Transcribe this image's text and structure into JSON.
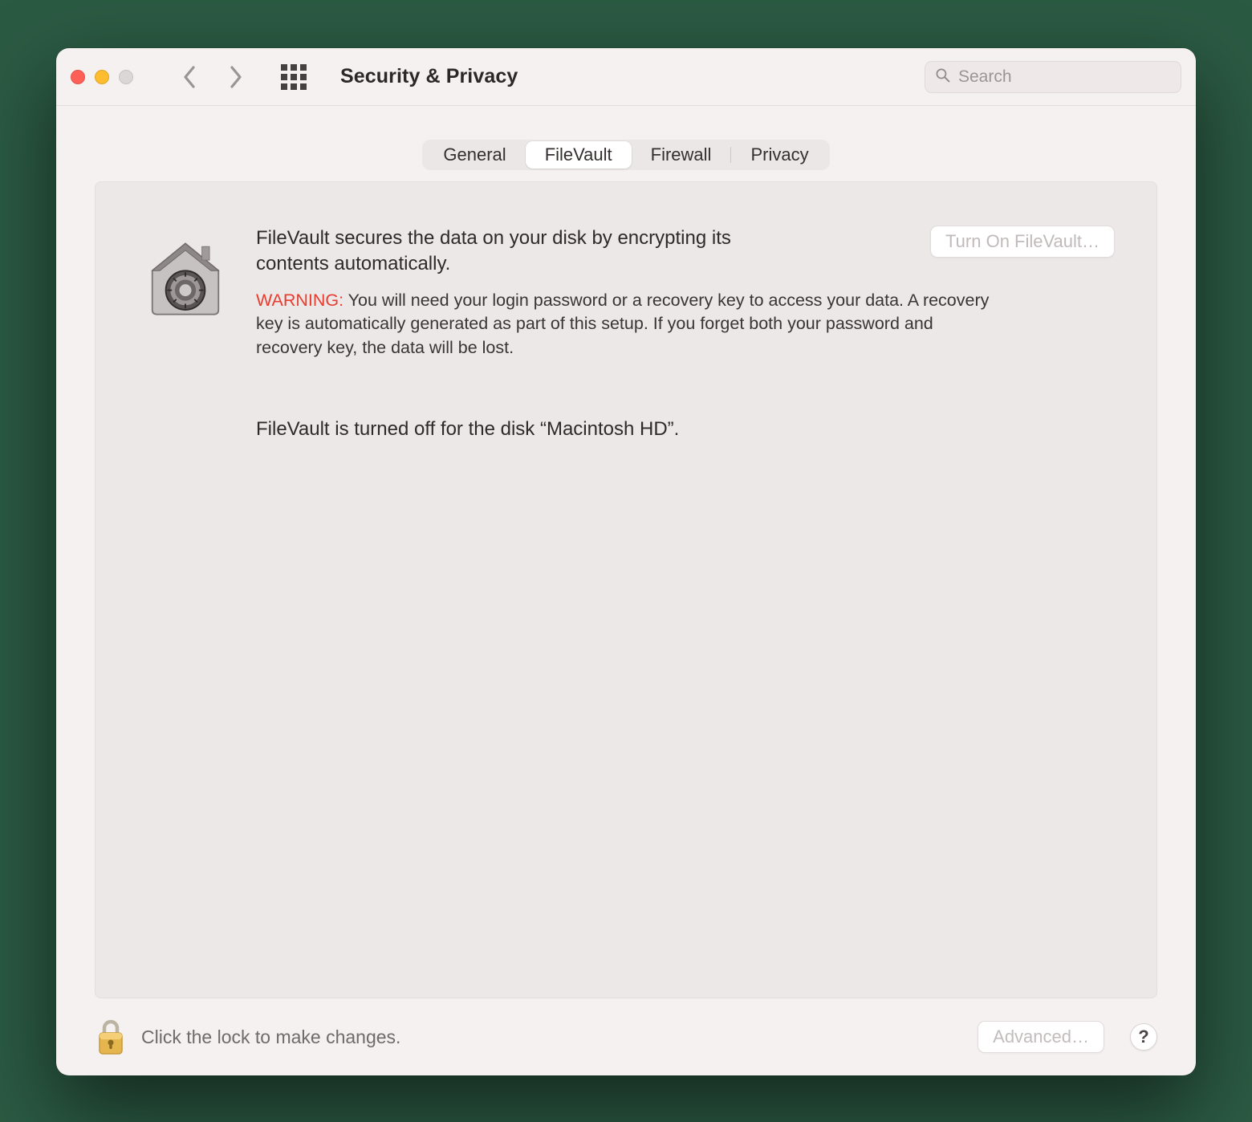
{
  "window": {
    "title": "Security & Privacy"
  },
  "search": {
    "placeholder": "Search"
  },
  "tabs": {
    "general": "General",
    "filevault": "FileVault",
    "firewall": "Firewall",
    "privacy": "Privacy"
  },
  "content": {
    "intro": "FileVault secures the data on your disk by encrypting its contents automatically.",
    "turn_on_label": "Turn On FileVault…",
    "warning_label": "WARNING:",
    "warning_text": " You will need your login password or a recovery key to access your data. A recovery key is automatically generated as part of this setup. If you forget both your password and recovery key, the data will be lost.",
    "status": "FileVault is turned off for the disk “Macintosh HD”."
  },
  "footer": {
    "lock_text": "Click the lock to make changes.",
    "advanced_label": "Advanced…",
    "help_label": "?"
  }
}
